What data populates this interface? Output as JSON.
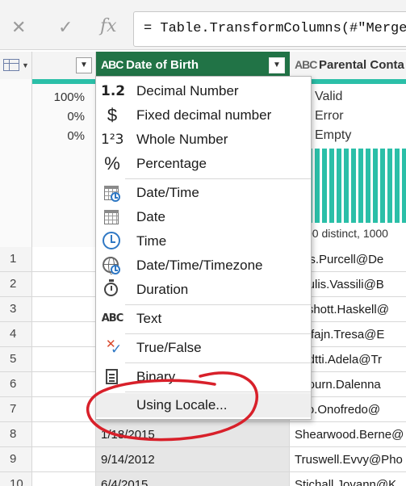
{
  "formula_bar": {
    "cancel_icon": "✕",
    "commit_icon": "✓",
    "fx_label": "fx",
    "formula": "= Table.TransformColumns(#\"Merged"
  },
  "headers": {
    "dob": {
      "type_badge": "ABC",
      "label": "Date of Birth"
    },
    "parent": {
      "type_badge": "ABC",
      "label": "Parental Conta"
    }
  },
  "profile": {
    "index_percents": [
      "100%",
      "0%",
      "0%"
    ],
    "parent_quality": [
      "Valid",
      "Error",
      "Empty"
    ],
    "distinct_text": "00 distinct, 1000",
    "bar_color": "#2bbfa8"
  },
  "rows": [
    {
      "num": "1",
      "dob": "",
      "parent": "llies.Purcell@De"
    },
    {
      "num": "2",
      "dob": "",
      "parent": "driulis.Vassili@B"
    },
    {
      "num": "3",
      "dob": "",
      "parent": "keshott.Haskell@"
    },
    {
      "num": "4",
      "dob": "",
      "parent": "oinfajn.Tresa@E"
    },
    {
      "num": "5",
      "dob": "",
      "parent": "nedtti.Adela@Tr"
    },
    {
      "num": "6",
      "dob": "",
      "parent": "ebourn.Dalenna"
    },
    {
      "num": "7",
      "dob": "",
      "parent": "nko.Onofredo@"
    },
    {
      "num": "8",
      "dob": "1/18/2015",
      "parent": "Shearwood.Berne@"
    },
    {
      "num": "9",
      "dob": "9/14/2012",
      "parent": "Truswell.Evvy@Pho"
    },
    {
      "num": "10",
      "dob": "6/4/2015",
      "parent": "Stichall.Jovann@K"
    }
  ],
  "menu": {
    "items": [
      {
        "icon": "decimal-number-icon",
        "glyph": "1.2",
        "label": "Decimal Number"
      },
      {
        "icon": "fixed-decimal-icon",
        "glyph": "$",
        "label": "Fixed decimal number"
      },
      {
        "icon": "whole-number-icon",
        "glyph": "1²3",
        "label": "Whole Number"
      },
      {
        "icon": "percentage-icon",
        "glyph": "%",
        "label": "Percentage"
      },
      {
        "icon": "date-time-icon",
        "glyph": "",
        "label": "Date/Time"
      },
      {
        "icon": "date-icon",
        "glyph": "",
        "label": "Date"
      },
      {
        "icon": "time-icon",
        "glyph": "",
        "label": "Time"
      },
      {
        "icon": "date-time-timezone-icon",
        "glyph": "",
        "label": "Date/Time/Timezone"
      },
      {
        "icon": "duration-icon",
        "glyph": "",
        "label": "Duration"
      },
      {
        "icon": "text-icon",
        "glyph": "ABC",
        "label": "Text"
      },
      {
        "icon": "true-false-icon",
        "glyph": "",
        "label": "True/False"
      },
      {
        "icon": "binary-icon",
        "glyph": "",
        "label": "Binary"
      },
      {
        "icon": "",
        "glyph": "",
        "label": "Using Locale..."
      }
    ]
  },
  "colors": {
    "accent_header": "#217346",
    "annotation": "#d8202a"
  }
}
